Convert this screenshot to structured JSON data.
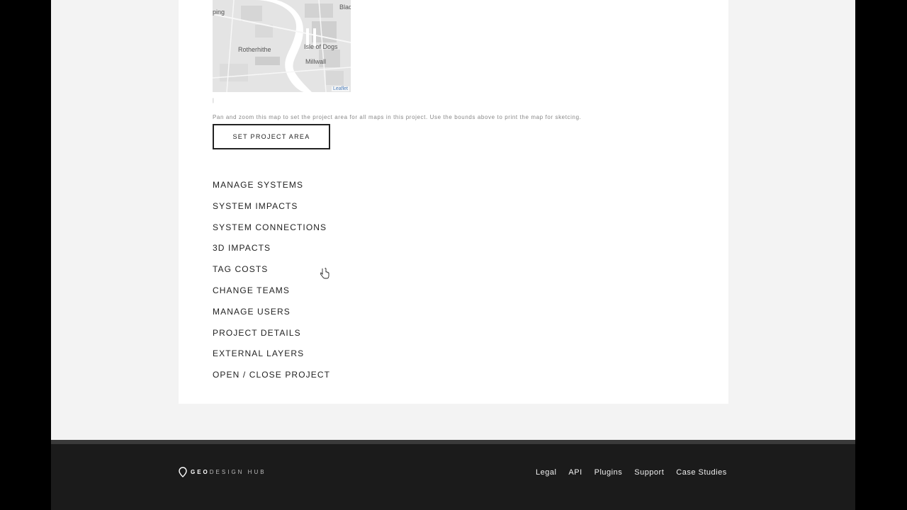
{
  "map": {
    "labels": [
      {
        "name": "place-label-ping",
        "text": "ping"
      },
      {
        "name": "place-label-rotherhithe",
        "text": "Rotherhithe"
      },
      {
        "name": "place-label-isle-of-dogs",
        "text": "Isle of Dogs"
      },
      {
        "name": "place-label-millwall",
        "text": "Millwall"
      },
      {
        "name": "place-label-blac",
        "text": "Blac"
      }
    ],
    "attribution": "Leaflet"
  },
  "help_text": "Pan and zoom this map to set the project area for all maps in this project. Use the bounds above to print the map for sketcing.",
  "set_button_label": "SET PROJECT AREA",
  "menu_items": [
    "MANAGE SYSTEMS",
    "SYSTEM IMPACTS",
    "SYSTEM CONNECTIONS",
    "3D IMPACTS",
    "TAG COSTS",
    "CHANGE TEAMS",
    "MANAGE USERS",
    "PROJECT DETAILS",
    "EXTERNAL LAYERS",
    "OPEN / CLOSE PROJECT"
  ],
  "footer": {
    "logo_part1": "GEO",
    "logo_part2": "DESIGN HUB",
    "links": [
      "Legal",
      "API",
      "Plugins",
      "Support",
      "Case Studies"
    ]
  },
  "colors": {
    "footer_bg": "#1b1b1b",
    "page_bg": "#f3f3f3",
    "card_bg": "#ffffff",
    "text": "#222222"
  }
}
